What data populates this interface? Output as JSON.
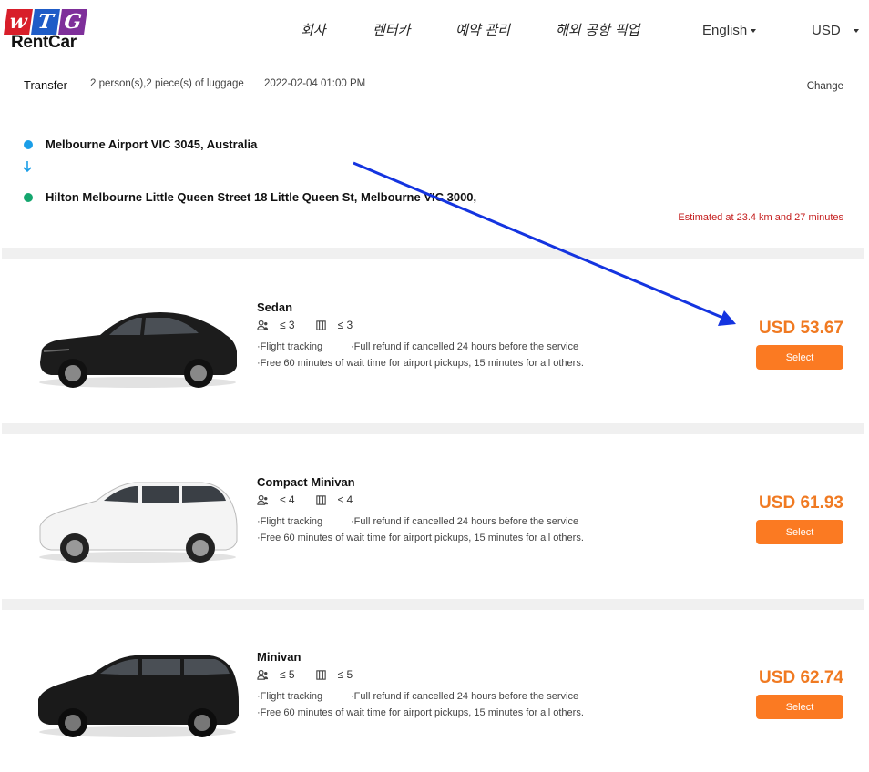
{
  "header": {
    "logo": {
      "letters": [
        "w",
        "T",
        "G"
      ],
      "brand": "RentCar"
    },
    "nav": [
      "회사",
      "렌터카",
      "예약 관리",
      "해외 공항 픽업"
    ],
    "language": "English",
    "currency": "USD"
  },
  "trip": {
    "type": "Transfer",
    "passengers": "2 person(s),2 piece(s) of luggage",
    "datetime": "2022-02-04 01:00 PM",
    "change_label": "Change",
    "origin": "Melbourne Airport VIC 3045, Australia",
    "destination": "Hilton Melbourne Little Queen Street 18 Little Queen St, Melbourne VIC 3000,",
    "estimate": "Estimated at 23.4 km and 27 minutes"
  },
  "vehicles": [
    {
      "name": "Sedan",
      "passengers": "≤ 3",
      "luggage": "≤ 3",
      "feature_1": "·Flight tracking",
      "feature_2": "·Full refund if cancelled 24 hours before the service",
      "feature_3": "·Free 60 minutes of wait time for airport pickups, 15 minutes for all others.",
      "price": "USD 53.67",
      "select_label": "Select",
      "color": "#1c1c1c"
    },
    {
      "name": "Compact Minivan",
      "passengers": "≤ 4",
      "luggage": "≤ 4",
      "feature_1": "·Flight tracking",
      "feature_2": "·Full refund if cancelled 24 hours before the service",
      "feature_3": "·Free 60 minutes of wait time for airport pickups, 15 minutes for all others.",
      "price": "USD 61.93",
      "select_label": "Select",
      "color": "#f4f4f4"
    },
    {
      "name": "Minivan",
      "passengers": "≤ 5",
      "luggage": "≤ 5",
      "feature_1": "·Flight tracking",
      "feature_2": "·Full refund if cancelled 24 hours before the service",
      "feature_3": "·Free 60 minutes of wait time for airport pickups, 15 minutes for all others.",
      "price": "USD 62.74",
      "select_label": "Select",
      "color": "#1a1a1a"
    }
  ],
  "colors": {
    "accent": "#fb7a22",
    "price": "#f07a22",
    "origin_dot": "#1a9ee8",
    "destination_dot": "#14a66e",
    "estimate": "#c41d1d",
    "annotation_arrow": "#1434e0"
  }
}
